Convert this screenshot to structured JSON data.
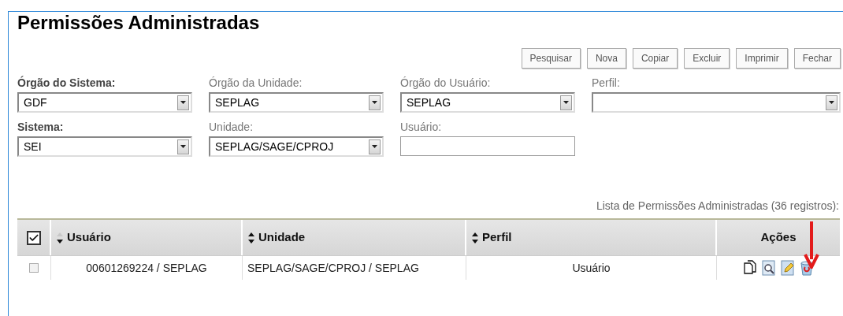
{
  "title": "Permissões Administradas",
  "buttons": [
    "Pesquisar",
    "Nova",
    "Copiar",
    "Excluir",
    "Imprimir",
    "Fechar"
  ],
  "filter_rows": [
    [
      {
        "label": "Órgão do Sistema:",
        "required": true,
        "kind": "select",
        "value": "GDF"
      },
      {
        "label": "Órgão da Unidade:",
        "required": false,
        "kind": "select",
        "value": "SEPLAG"
      },
      {
        "label": "Órgão do Usuário:",
        "required": false,
        "kind": "select",
        "value": "SEPLAG"
      },
      {
        "label": "Perfil:",
        "required": false,
        "kind": "select"
      }
    ],
    [
      {
        "label": "Sistema:",
        "required": true,
        "kind": "select",
        "value": "SEI"
      },
      {
        "label": "Unidade:",
        "required": false,
        "kind": "select",
        "value": "SEPLAG/SAGE/CPROJ"
      },
      {
        "label": "Usuário:",
        "required": false,
        "kind": "text"
      }
    ]
  ],
  "table": {
    "caption": "Lista de Permissões Administradas (36 registros):",
    "all_checked": true,
    "columns": [
      {
        "label": "Usuário",
        "sortable": true,
        "sorted": true
      },
      {
        "label": "Unidade",
        "sortable": true,
        "sorted": false
      },
      {
        "label": "Perfil",
        "sortable": true,
        "sorted": false
      },
      {
        "label": "Ações",
        "sortable": false
      }
    ],
    "rows": [
      {
        "checked": false,
        "cells": [
          "00601269224 / SEPLAG",
          "SEPLAG/SAGE/CPROJ / SEPLAG",
          "Usuário"
        ],
        "actions": [
          {
            "kind": "copy"
          },
          {
            "kind": "view"
          },
          {
            "kind": "edit"
          },
          {
            "kind": "delete"
          }
        ]
      }
    ]
  }
}
